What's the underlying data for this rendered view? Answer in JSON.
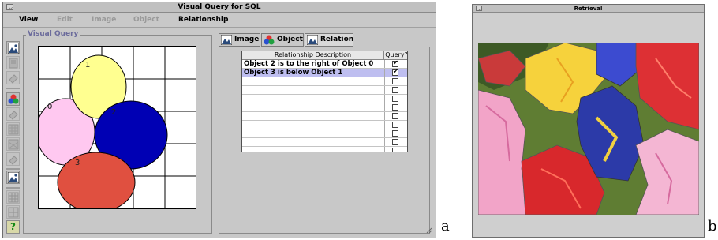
{
  "window_a": {
    "title": "Visual Query for SQL",
    "menu": [
      {
        "label": "View",
        "enabled": true
      },
      {
        "label": "Edit",
        "enabled": false
      },
      {
        "label": "Image",
        "enabled": false
      },
      {
        "label": "Object",
        "enabled": false
      },
      {
        "label": "Relationship",
        "enabled": true
      }
    ],
    "group_label": "Visual Query",
    "toolbar_icons": [
      "image-icon",
      "document-icon",
      "eraser-icon",
      "color-shapes-icon",
      "eraser-icon",
      "texture-icon",
      "texture-icon",
      "eraser-icon",
      "image-icon",
      "grid-icon",
      "grid-icon",
      "help-icon"
    ],
    "help_glyph": "?",
    "objects": [
      {
        "label": "0",
        "color": "#ffc8f0"
      },
      {
        "label": "1",
        "color": "#ffff90"
      },
      {
        "label": "2",
        "color": "#0000b4"
      },
      {
        "label": "3",
        "color": "#e05040"
      }
    ],
    "tabs": [
      {
        "label": "Image",
        "active": false
      },
      {
        "label": "Object",
        "active": false
      },
      {
        "label": "Relation",
        "active": true
      }
    ],
    "table": {
      "headers": [
        "Relationship Description",
        "Query?"
      ],
      "rows": [
        {
          "description": "Object 2 is to the right of Object 0",
          "query": true,
          "selected": false
        },
        {
          "description": "Object 3 is below Object 1",
          "query": true,
          "selected": true
        },
        {
          "description": "",
          "query": false,
          "selected": false
        },
        {
          "description": "",
          "query": false,
          "selected": false
        },
        {
          "description": "",
          "query": false,
          "selected": false
        },
        {
          "description": "",
          "query": false,
          "selected": false
        },
        {
          "description": "",
          "query": false,
          "selected": false
        },
        {
          "description": "",
          "query": false,
          "selected": false
        },
        {
          "description": "",
          "query": false,
          "selected": false
        },
        {
          "description": "",
          "query": false,
          "selected": false
        },
        {
          "description": "",
          "query": false,
          "selected": false
        }
      ]
    },
    "caption": "a"
  },
  "window_b": {
    "title": "Retrieval",
    "image_description": "flowers",
    "caption": "b"
  },
  "colors": {
    "window_bg": "#c8c8c8",
    "selected_row": "#bebef0",
    "group_label": "#6c6c9c"
  }
}
